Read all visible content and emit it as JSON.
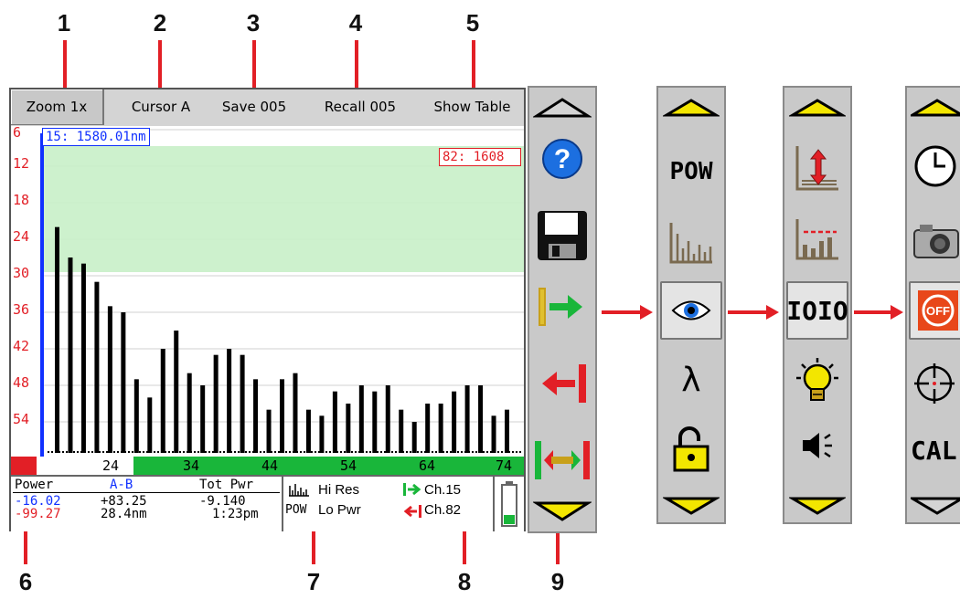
{
  "callouts": [
    "1",
    "2",
    "3",
    "4",
    "5",
    "6",
    "7",
    "8",
    "9"
  ],
  "toolbar": {
    "zoom": "Zoom  1x",
    "cursor": "Cursor  A",
    "save": "Save 005",
    "recall": "Recall 005",
    "show_table": "Show Table"
  },
  "plot": {
    "y_labels": [
      "6",
      "12",
      "18",
      "24",
      "30",
      "36",
      "42",
      "48",
      "54"
    ],
    "cursor_a": "15:  1580.01nm",
    "cursor_b": "82:  1608",
    "bar_depths": [
      22,
      27,
      28,
      31,
      35,
      36,
      47,
      50,
      42,
      39,
      46,
      48,
      43,
      42,
      43,
      47,
      52,
      47,
      46,
      52,
      53,
      49,
      51,
      48,
      49,
      48,
      52,
      54,
      51,
      51,
      49,
      48,
      48,
      53,
      52
    ],
    "grid_color": "#d0d0d0",
    "band_color": "#c8f0c8",
    "cursor_a_color": "#1030ff",
    "cursor_b_color": "#e21f26"
  },
  "channel_axis": {
    "ticks": [
      "24",
      "34",
      "44",
      "54",
      "64",
      "74"
    ],
    "green": "#19b63a"
  },
  "status": {
    "power_label": "Power",
    "ab_label": "A-B",
    "tot_pwr_label": "Tot Pwr",
    "power_a": "-16.02",
    "power_b": "-99.27",
    "ab_power": "+83.25",
    "ab_wavelength": "28.4nm",
    "tot_pwr_value": "-9.140",
    "time": "1:23pm",
    "hi_res": "Hi Res",
    "lo_pwr": "Lo Pwr",
    "pow_icon_label": "POW",
    "ch_a": "Ch.15",
    "ch_b": "Ch.82"
  },
  "panel_labels": {
    "pow": "POW",
    "lambda": "λ",
    "ioio": "IOIO",
    "off": "OFF",
    "cal": "CAL"
  }
}
